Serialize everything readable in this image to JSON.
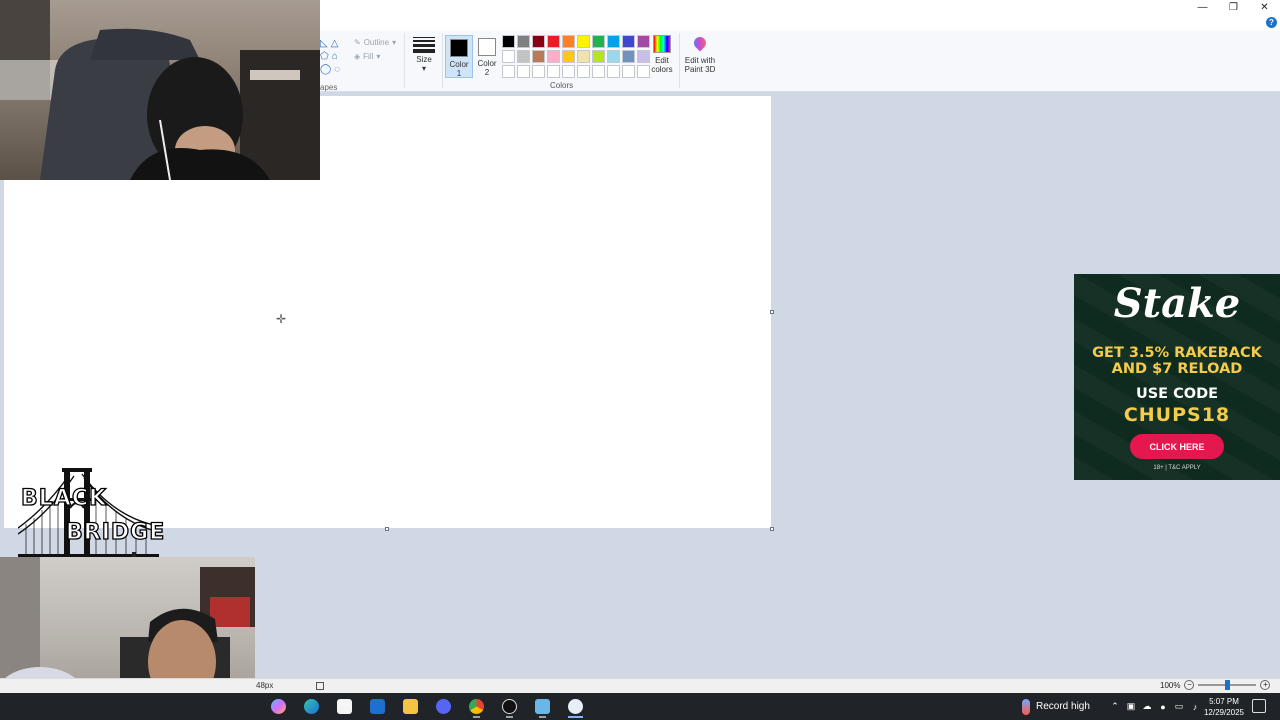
{
  "window": {
    "controls": [
      "—",
      "❐",
      "✕"
    ],
    "help_glyph": "?"
  },
  "ribbon": {
    "shapes": {
      "outline_label": "Outline",
      "fill_label": "Fill",
      "group_label": "apes"
    },
    "size_label": "Size",
    "color1_label": "Color 1",
    "color1_value": "#000000",
    "color2_label": "Color 2",
    "color2_value": "#ffffff",
    "palette": [
      "#000000",
      "#7f7f7f",
      "#880015",
      "#ed1c24",
      "#ff7f27",
      "#fff200",
      "#22b14c",
      "#00a2e8",
      "#3f48cc",
      "#a349a4",
      "#ffffff",
      "#c3c3c3",
      "#b97a57",
      "#ffaec9",
      "#ffc90e",
      "#efe4b0",
      "#b5e61d",
      "#99d9ea",
      "#7092be",
      "#c8bfe7",
      "#ffffff",
      "#ffffff",
      "#ffffff",
      "#ffffff",
      "#ffffff",
      "#ffffff",
      "#ffffff",
      "#ffffff",
      "#ffffff",
      "#ffffff"
    ],
    "colors_label": "Colors",
    "edit_colors_label": "Edit colors",
    "edit_3d_label": "Edit with Paint 3D"
  },
  "canvas": {
    "logo": {
      "line1": "BLACK",
      "line2": "BRIDGE"
    }
  },
  "ad": {
    "brand": "Stake",
    "offer_line1": "GET 3.5% RAKEBACK",
    "offer_line2": "AND $7 RELOAD",
    "use_code": "USE CODE",
    "code": "CHUPS18",
    "button": "CLICK HERE",
    "terms": "18+ | T&C APPLY",
    "bg_color": "#0f2a1e",
    "accent_color": "#f5cb4a"
  },
  "statusbar": {
    "dimension_fragment": "48px",
    "zoom_level": "100%",
    "zoom_fraction": 0.5
  },
  "taskbar": {
    "weather_text": "Record high",
    "time": "5:07 PM",
    "date": "12/29/2025",
    "apps": [
      "copilot-icon",
      "edge-icon",
      "store-icon",
      "outlook-icon",
      "file-explorer-icon",
      "discord-icon",
      "chrome-icon",
      "obs-icon",
      "notepad-icon",
      "paint-icon"
    ]
  }
}
